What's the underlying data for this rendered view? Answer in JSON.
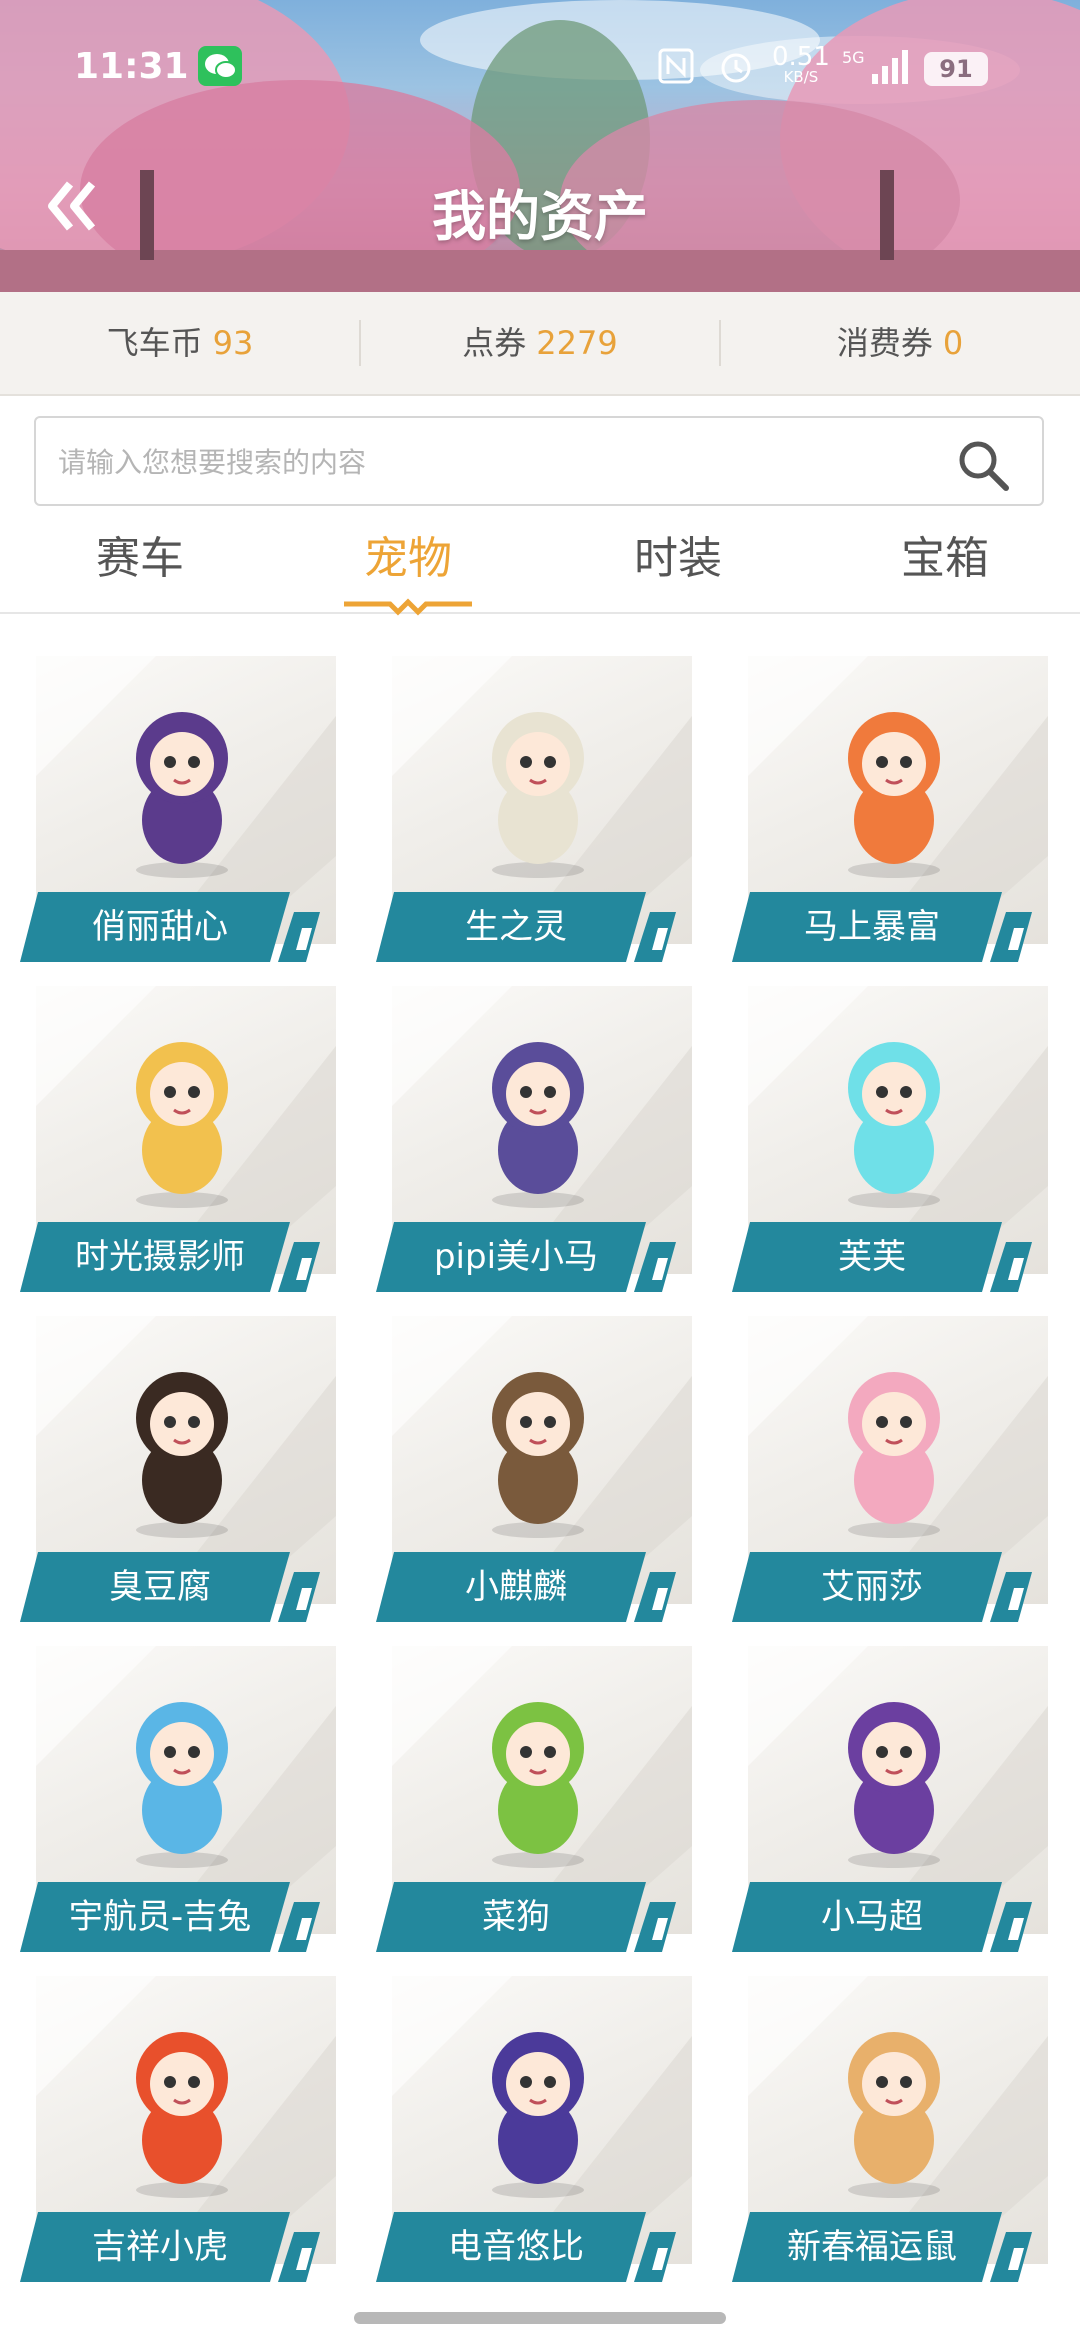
{
  "status_bar": {
    "time": "11:31",
    "speed_value": "0.51",
    "speed_unit": "KB/S",
    "network": "5G",
    "battery": "91"
  },
  "header": {
    "title": "我的资产"
  },
  "currency": [
    {
      "label": "飞车币",
      "value": "93"
    },
    {
      "label": "点券",
      "value": "2279"
    },
    {
      "label": "消费券",
      "value": "0"
    }
  ],
  "search": {
    "placeholder": "请输入您想要搜索的内容",
    "value": ""
  },
  "tabs": [
    {
      "label": "赛车",
      "active": false
    },
    {
      "label": "宠物",
      "active": true
    },
    {
      "label": "时装",
      "active": false
    },
    {
      "label": "宝箱",
      "active": false
    }
  ],
  "pets": [
    {
      "name": "俏丽甜心",
      "icon": "purple-hair-girl-icon",
      "color": "#5b3b8c"
    },
    {
      "name": "生之灵",
      "icon": "white-spirit-girl-icon",
      "color": "#e8e3d2"
    },
    {
      "name": "马上暴富",
      "icon": "gold-horse-icon",
      "color": "#f07a3c"
    },
    {
      "name": "时光摄影师",
      "icon": "photographer-girl-icon",
      "color": "#f2c14e"
    },
    {
      "name": "pipi美小马",
      "icon": "pony-icon",
      "color": "#5a4d9a"
    },
    {
      "name": "芙芙",
      "icon": "cyan-hair-girl-icon",
      "color": "#6fe0e8"
    },
    {
      "name": "臭豆腐",
      "icon": "stinky-tofu-bowl-icon",
      "color": "#3a2a22"
    },
    {
      "name": "小麒麟",
      "icon": "kirin-icon",
      "color": "#7a5a3c"
    },
    {
      "name": "艾丽莎",
      "icon": "pink-bunny-girl-icon",
      "color": "#f3a9bf"
    },
    {
      "name": "宇航员-吉兔",
      "icon": "astronaut-robot-icon",
      "color": "#5ab6e6"
    },
    {
      "name": "菜狗",
      "icon": "cabbage-dog-icon",
      "color": "#7cc242"
    },
    {
      "name": "小马超",
      "icon": "warrior-boy-icon",
      "color": "#6b3fa0"
    },
    {
      "name": "吉祥小虎",
      "icon": "lucky-tiger-icon",
      "color": "#e8502c"
    },
    {
      "name": "电音悠比",
      "icon": "music-rabbit-icon",
      "color": "#4b3a9a"
    },
    {
      "name": "新春福运鼠",
      "icon": "hamster-icon",
      "color": "#e8b06b"
    }
  ]
}
